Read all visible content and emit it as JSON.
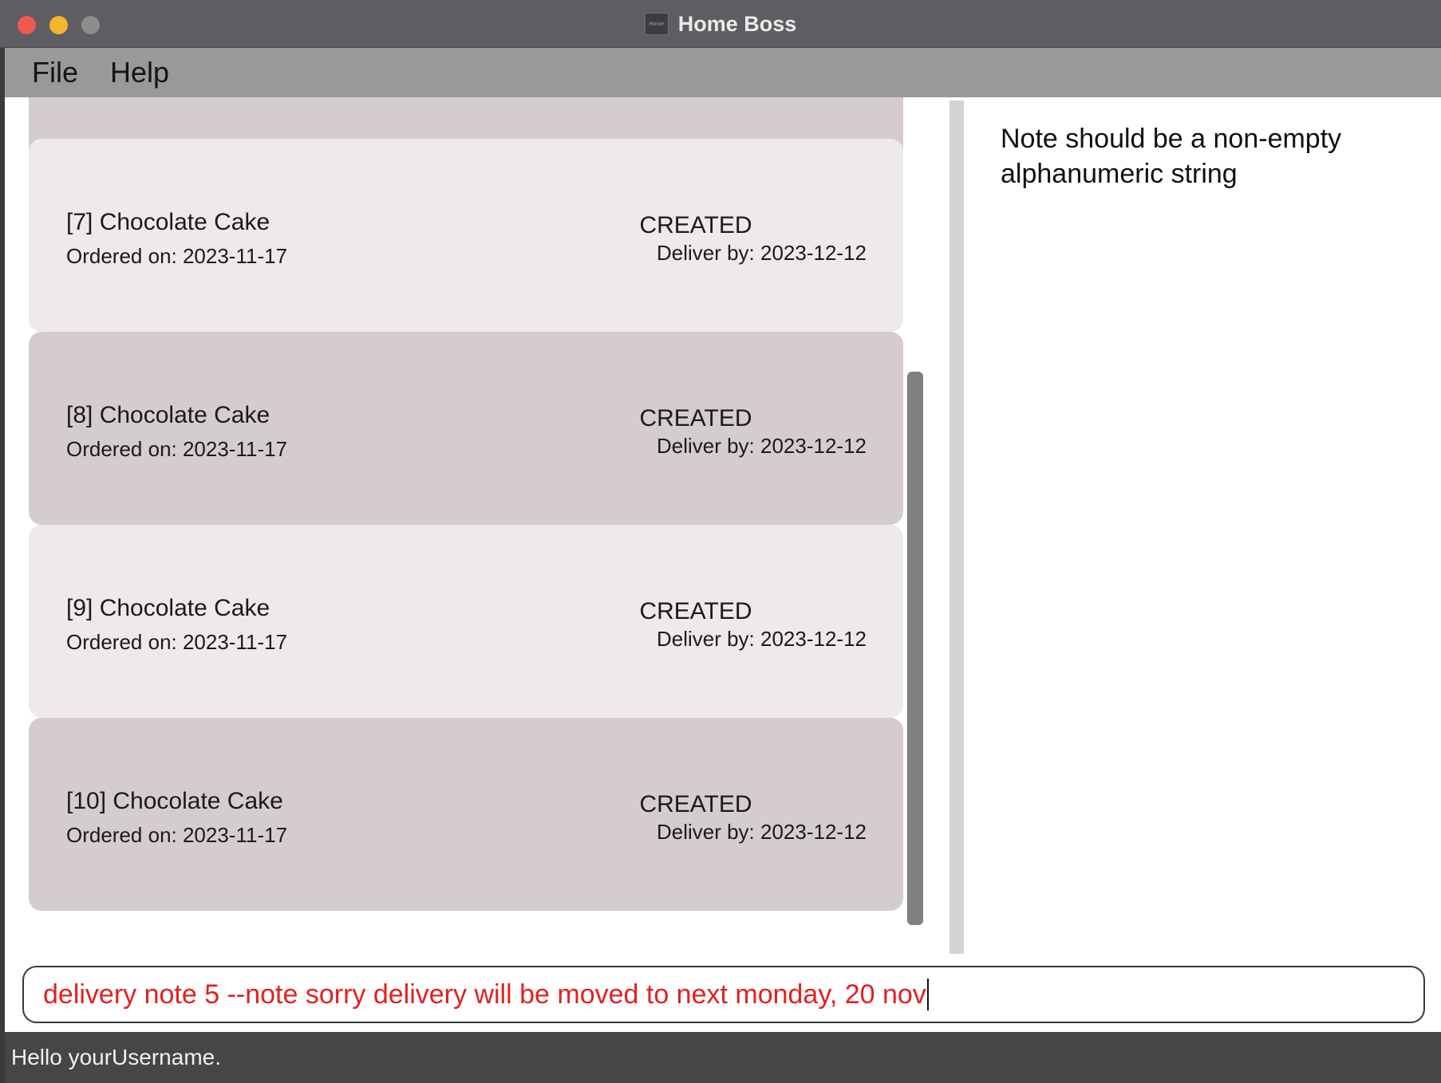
{
  "window": {
    "title": "Home Boss",
    "app_icon_text": "Home"
  },
  "menu": {
    "items": [
      "File",
      "Help"
    ]
  },
  "deliveries": [
    {
      "title": "[7] Chocolate Cake",
      "ordered": "Ordered on: 2023-11-17",
      "status": "CREATED",
      "deliver_by": "Deliver by: 2023-12-12"
    },
    {
      "title": "[8] Chocolate Cake",
      "ordered": "Ordered on: 2023-11-17",
      "status": "CREATED",
      "deliver_by": "Deliver by: 2023-12-12"
    },
    {
      "title": "[9] Chocolate Cake",
      "ordered": "Ordered on: 2023-11-17",
      "status": "CREATED",
      "deliver_by": "Deliver by: 2023-12-12"
    },
    {
      "title": "[10] Chocolate Cake",
      "ordered": "Ordered on: 2023-11-17",
      "status": "CREATED",
      "deliver_by": "Deliver by: 2023-12-12"
    }
  ],
  "result": {
    "message": "Note should be a non-empty alphanumeric string"
  },
  "command": {
    "value": "delivery note 5 --note sorry delivery will be moved to next monday, 20 nov"
  },
  "status": {
    "text": "Hello yourUsername."
  },
  "colors": {
    "error_text": "#e32020",
    "card_light": "#eeeaea",
    "card_dark": "#d5cdcd",
    "titlebar": "#5f5d61",
    "menubar": "#999999",
    "statusbar": "#464646"
  }
}
